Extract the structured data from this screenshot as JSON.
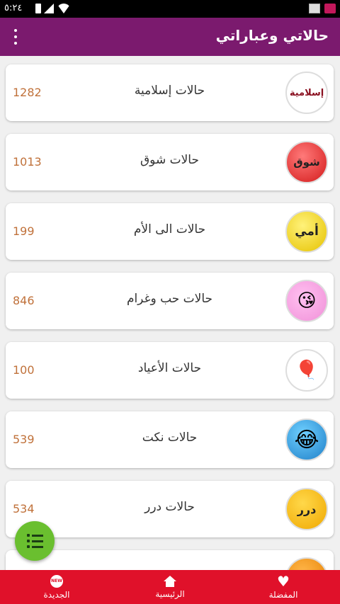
{
  "statusbar": {
    "time": "٥:٢٤"
  },
  "appbar": {
    "title": "حالاتي وعباراتي",
    "menu_icon": "more-vertical-icon"
  },
  "categories": [
    {
      "label": "حالات إسلامية",
      "count": "1282",
      "icon_text": "إسلامية"
    },
    {
      "label": "حالات  شوق",
      "count": "1013",
      "icon_text": "شوق"
    },
    {
      "label": "حالات  الى الأم",
      "count": "199",
      "icon_text": "أمي"
    },
    {
      "label": "حالات  حب وغرام",
      "count": "846",
      "icon_text": "😘"
    },
    {
      "label": "حالات الأعياد",
      "count": "100",
      "icon_text": "🎈"
    },
    {
      "label": "حالات نكت",
      "count": "539",
      "icon_text": "😂"
    },
    {
      "label": "حالات درر",
      "count": "534",
      "icon_text": "درر"
    }
  ],
  "bottom_nav": {
    "favorites": "المفضلة",
    "home": "الرئيسية",
    "new": "الجديدة",
    "new_badge": "NEW"
  },
  "colors": {
    "appbar": "#7b1a6e",
    "bottom_nav": "#e0112a",
    "fab": "#6abf2f",
    "count": "#c0713a"
  }
}
